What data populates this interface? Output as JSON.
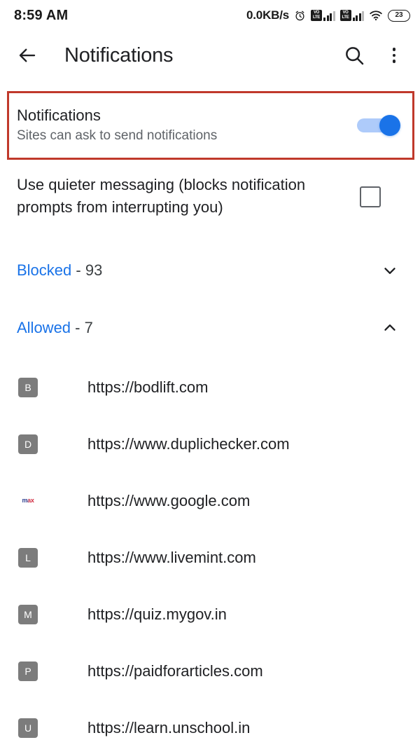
{
  "status_bar": {
    "time": "8:59 AM",
    "network_speed": "0.0KB/s",
    "alarm_icon": "alarm-clock-icon",
    "sim1_volte": "VoLTE",
    "sim2_volte": "VoLTE",
    "wifi_icon": "wifi-icon",
    "battery_level": "23"
  },
  "app_bar": {
    "back_icon": "back-arrow-icon",
    "title": "Notifications",
    "search_icon": "search-icon",
    "overflow_icon": "more-vertical-icon"
  },
  "master_toggle": {
    "title": "Notifications",
    "subtitle": "Sites can ask to send notifications",
    "state": "on"
  },
  "quieter_messaging": {
    "label": "Use quieter messaging (blocks notification prompts from interrupting you)",
    "checked": "false"
  },
  "groups": [
    {
      "name": "Blocked",
      "count": "- 93",
      "expanded": "false",
      "chevron": "chevron-down-icon"
    },
    {
      "name": "Allowed",
      "count": "- 7",
      "expanded": "true",
      "chevron": "chevron-up-icon"
    }
  ],
  "allowed_sites": [
    {
      "favicon_letter": "B",
      "favicon_type": "letter",
      "url": "https://bodlift.com"
    },
    {
      "favicon_letter": "D",
      "favicon_type": "letter",
      "url": "https://www.duplichecker.com"
    },
    {
      "favicon_letter": "max",
      "favicon_type": "image",
      "url": "https://www.google.com"
    },
    {
      "favicon_letter": "L",
      "favicon_type": "letter",
      "url": "https://www.livemint.com"
    },
    {
      "favicon_letter": "M",
      "favicon_type": "letter",
      "url": "https://quiz.mygov.in"
    },
    {
      "favicon_letter": "P",
      "favicon_type": "letter",
      "url": "https://paidforarticles.com"
    },
    {
      "favicon_letter": "U",
      "favicon_type": "letter",
      "url": "https://learn.unschool.in"
    }
  ],
  "colors": {
    "accent_blue": "#1a73e8",
    "toggle_track": "#aecbfa",
    "highlight_border": "#c0392b",
    "text_primary": "#202124",
    "text_secondary": "#5f6368",
    "favicon_bg": "#7c7c7c"
  }
}
